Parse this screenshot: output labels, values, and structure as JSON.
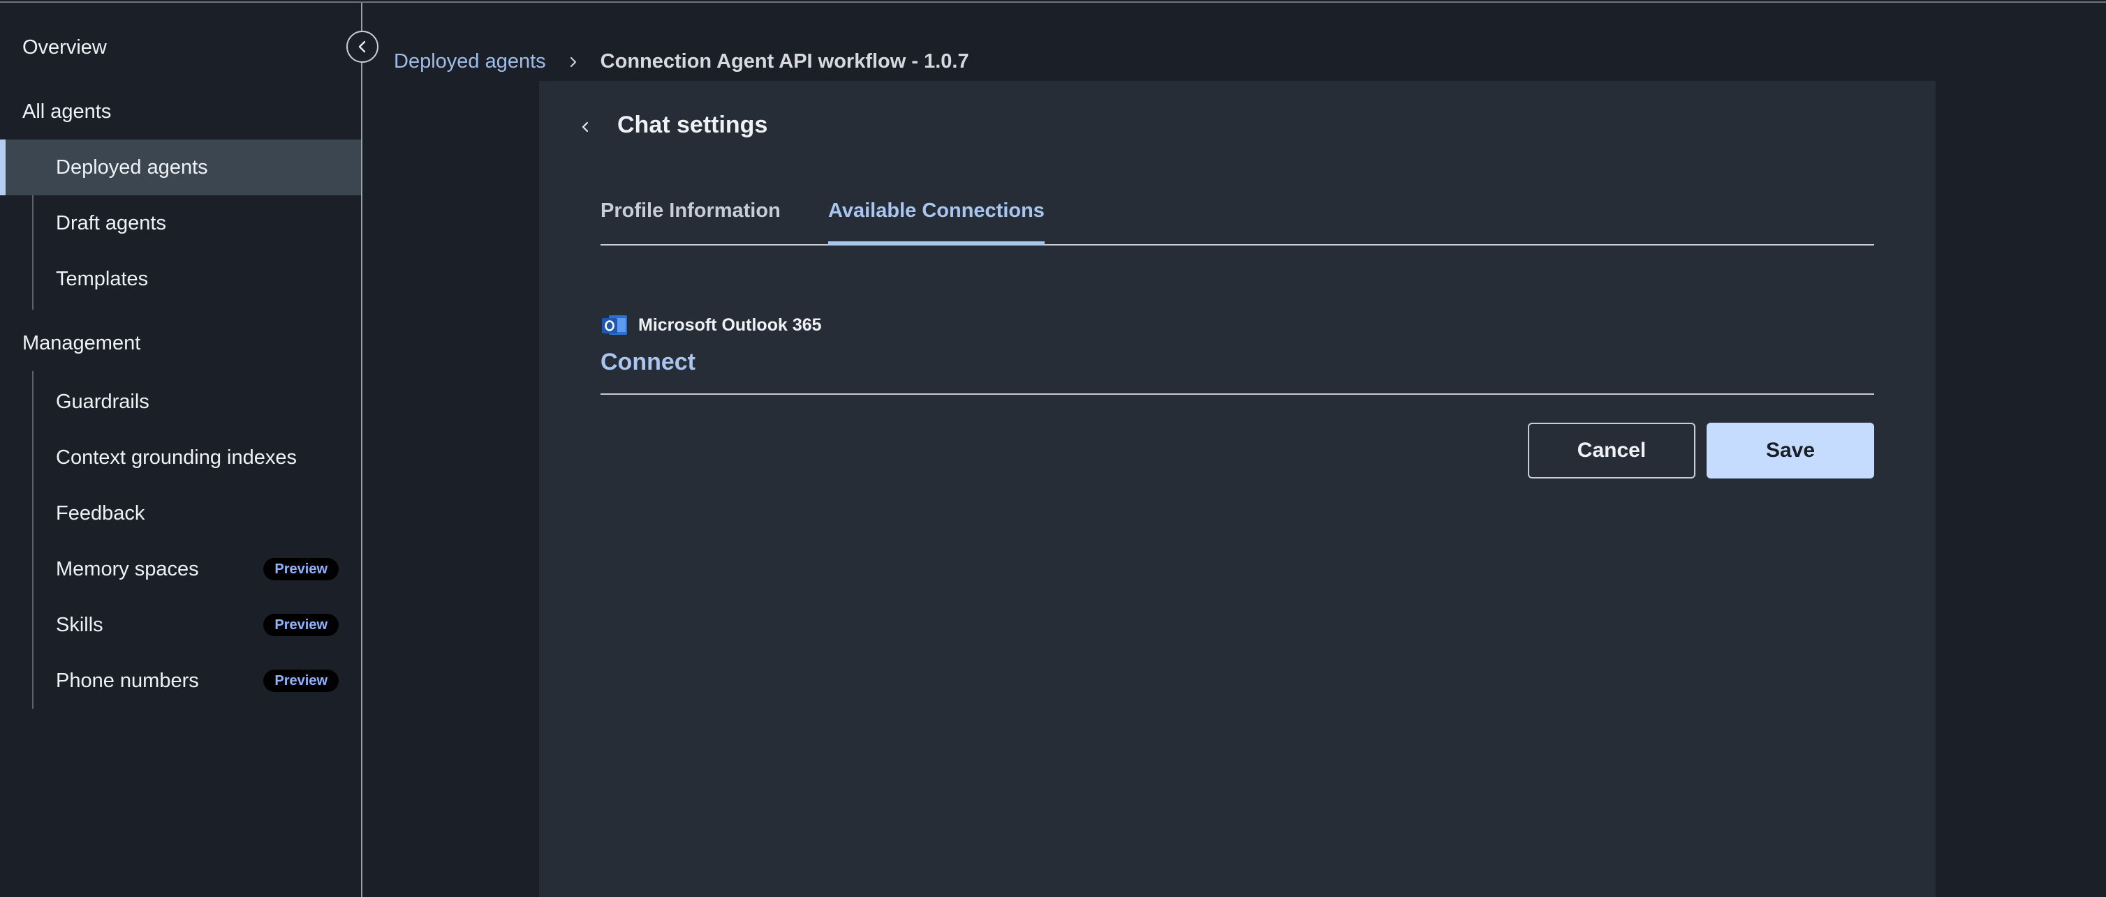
{
  "sidebar": {
    "overview": "Overview",
    "all_agents": "All agents",
    "agents_items": [
      {
        "label": "Deployed agents",
        "active": true
      },
      {
        "label": "Draft agents"
      },
      {
        "label": "Templates"
      }
    ],
    "management": "Management",
    "management_items": [
      {
        "label": "Guardrails"
      },
      {
        "label": "Context grounding indexes"
      },
      {
        "label": "Feedback"
      },
      {
        "label": "Memory spaces",
        "badge": "Preview"
      },
      {
        "label": "Skills",
        "badge": "Preview"
      },
      {
        "label": "Phone numbers",
        "badge": "Preview"
      }
    ]
  },
  "breadcrumb": {
    "parent": "Deployed agents",
    "current": "Connection Agent API workflow - 1.0.7"
  },
  "panel": {
    "title": "Chat settings",
    "tabs": [
      "Profile Information",
      "Available Connections"
    ],
    "active_tab": "Available Connections",
    "connection": {
      "icon": "outlook-icon",
      "name": "Microsoft Outlook 365",
      "action": "Connect"
    },
    "cancel_label": "Cancel",
    "save_label": "Save"
  },
  "colors": {
    "background": "#1b1f27",
    "panel": "#272d36",
    "accent": "#a9c6f0",
    "save_button": "#c6dcff",
    "active_nav": "#3b4651"
  }
}
